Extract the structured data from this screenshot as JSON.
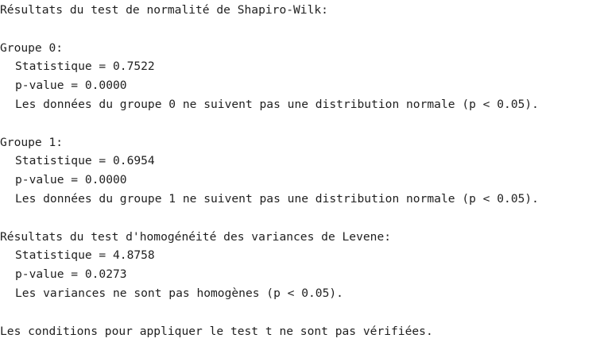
{
  "output": {
    "shapiro_header": "Résultats du test de normalité de Shapiro-Wilk:",
    "group0": {
      "title": "Groupe 0:",
      "statistic": "Statistique = 0.7522",
      "pvalue": "p-value = 0.0000",
      "conclusion": "Les données du groupe 0 ne suivent pas une distribution normale (p < 0.05)."
    },
    "group1": {
      "title": "Groupe 1:",
      "statistic": "Statistique = 0.6954",
      "pvalue": "p-value = 0.0000",
      "conclusion": "Les données du groupe 1 ne suivent pas une distribution normale (p < 0.05)."
    },
    "levene": {
      "title": "Résultats du test d'homogénéité des variances de Levene:",
      "statistic": "Statistique = 4.8758",
      "pvalue": "p-value = 0.0273",
      "conclusion": "Les variances ne sont pas homogènes (p < 0.05)."
    },
    "final_conclusion": "Les conditions pour appliquer le test t ne sont pas vérifiées."
  }
}
